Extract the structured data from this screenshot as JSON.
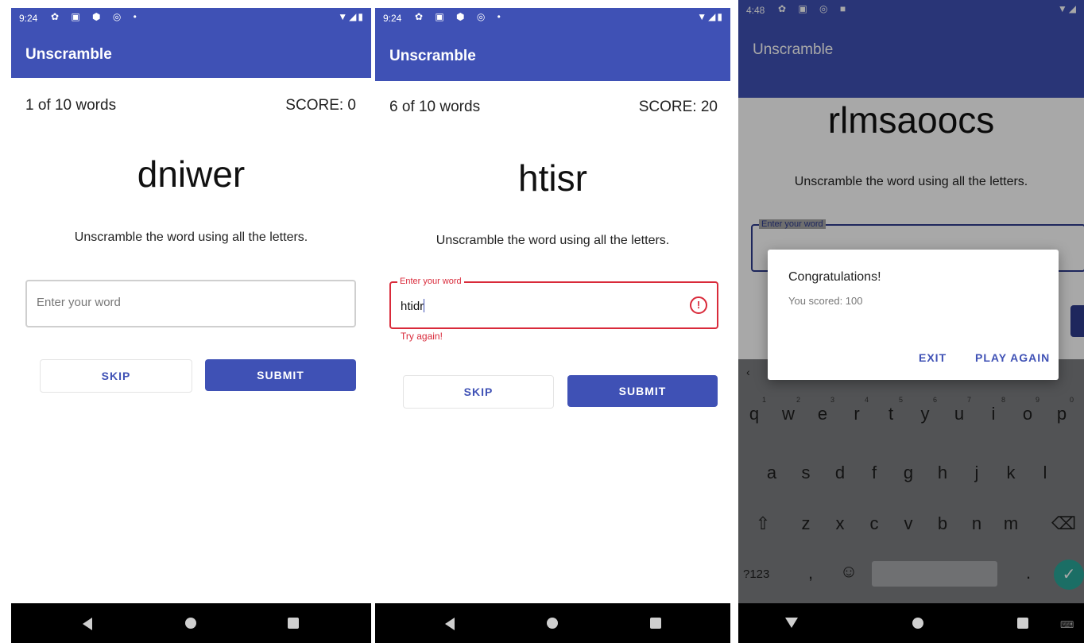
{
  "phones": [
    {
      "status": {
        "time": "9:24",
        "icons": "✿ ▣ ⬢ ◎ •",
        "right": "▼◢▮"
      },
      "app_title": "Unscramble",
      "counter": "1 of 10 words",
      "score": "SCORE: 0",
      "scrambled_word": "dniwer",
      "instruction": "Unscramble the word using all the letters.",
      "input": {
        "placeholder": "Enter your word"
      },
      "skip_label": "SKIP",
      "submit_label": "SUBMIT"
    },
    {
      "status": {
        "time": "9:24",
        "icons": "✿ ▣ ⬢ ◎ •",
        "right": "▼◢▮"
      },
      "app_title": "Unscramble",
      "counter": "6 of 10 words",
      "score": "SCORE: 20",
      "scrambled_word": "htisr",
      "instruction": "Unscramble the word using all the letters.",
      "input": {
        "label": "Enter your word",
        "value": "htidr",
        "error": "Try again!",
        "error_icon": "!"
      },
      "skip_label": "SKIP",
      "submit_label": "SUBMIT"
    },
    {
      "status": {
        "time": "4:48",
        "icons": "✿ ▣ ◎ ■",
        "right": "▼◢"
      },
      "app_title": "Unscramble",
      "scrambled_word": "rlmsaoocs",
      "instruction": "Unscramble the word using all the letters.",
      "input": {
        "label": "Enter your word"
      },
      "dialog": {
        "title": "Congratulations!",
        "message": "You scored: 100",
        "exit_label": "EXIT",
        "play_again_label": "PLAY AGAIN"
      },
      "keyboard": {
        "row1": [
          "q",
          "w",
          "e",
          "r",
          "t",
          "y",
          "u",
          "i",
          "o",
          "p"
        ],
        "row1_hints": [
          "1",
          "2",
          "3",
          "4",
          "5",
          "6",
          "7",
          "8",
          "9",
          "0"
        ],
        "row2": [
          "a",
          "s",
          "d",
          "f",
          "g",
          "h",
          "j",
          "k",
          "l"
        ],
        "row3": [
          "⇧",
          "z",
          "x",
          "c",
          "v",
          "b",
          "n",
          "m",
          "⌫"
        ],
        "symbols_key": "?123",
        "comma_key": ",",
        "emoji_key": "☺",
        "period_key": ".",
        "enter_key": "✓",
        "toolbar_key": "‹"
      }
    }
  ],
  "colors": {
    "primary": "#3f51b5",
    "primary_dark": "#2e3c8e",
    "error": "#d92a3a",
    "enter_key": "#2aa899"
  },
  "icons": {
    "back": "nav-back-icon",
    "home": "nav-home-icon",
    "recents": "nav-recents-icon",
    "error": "error-icon",
    "enter": "checkmark-icon"
  }
}
